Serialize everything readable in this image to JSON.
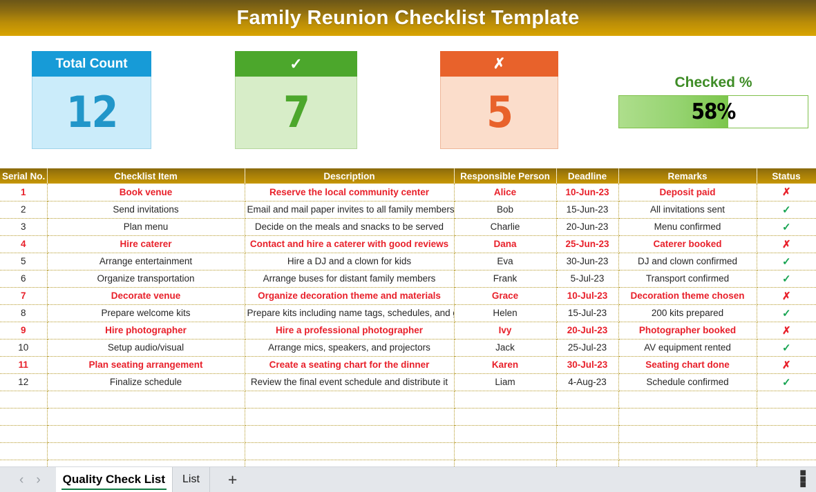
{
  "title": "Family Reunion Checklist Template",
  "cards": [
    {
      "name": "total-count",
      "header": "Total Count",
      "value": "12"
    },
    {
      "name": "checked-count",
      "header": "✓",
      "value": "7"
    },
    {
      "name": "unchecked-count",
      "header": "✗",
      "value": "5"
    }
  ],
  "progress": {
    "label": "Checked %",
    "value": "58%",
    "percent": 58
  },
  "table": {
    "columns": [
      "Serial No.",
      "Checklist Item",
      "Description",
      "Responsible Person",
      "Deadline",
      "Remarks",
      "Status"
    ],
    "rows": [
      {
        "serial": "1",
        "item": "Book venue",
        "desc": "Reserve the local community center",
        "person": "Alice",
        "deadline": "10-Jun-23",
        "remarks": "Deposit paid",
        "status": "✗",
        "flagged": true
      },
      {
        "serial": "2",
        "item": "Send invitations",
        "desc": "Email and mail paper invites to all family members",
        "person": "Bob",
        "deadline": "15-Jun-23",
        "remarks": "All invitations sent",
        "status": "✓",
        "flagged": false
      },
      {
        "serial": "3",
        "item": "Plan menu",
        "desc": "Decide on the meals and snacks to be served",
        "person": "Charlie",
        "deadline": "20-Jun-23",
        "remarks": "Menu confirmed",
        "status": "✓",
        "flagged": false
      },
      {
        "serial": "4",
        "item": "Hire caterer",
        "desc": "Contact and hire a caterer with good reviews",
        "person": "Dana",
        "deadline": "25-Jun-23",
        "remarks": "Caterer booked",
        "status": "✗",
        "flagged": true
      },
      {
        "serial": "5",
        "item": "Arrange entertainment",
        "desc": "Hire a DJ and a clown for kids",
        "person": "Eva",
        "deadline": "30-Jun-23",
        "remarks": "DJ and clown confirmed",
        "status": "✓",
        "flagged": false
      },
      {
        "serial": "6",
        "item": "Organize transportation",
        "desc": "Arrange buses for distant family members",
        "person": "Frank",
        "deadline": "5-Jul-23",
        "remarks": "Transport confirmed",
        "status": "✓",
        "flagged": false
      },
      {
        "serial": "7",
        "item": "Decorate venue",
        "desc": "Organize decoration theme and materials",
        "person": "Grace",
        "deadline": "10-Jul-23",
        "remarks": "Decoration theme chosen",
        "status": "✗",
        "flagged": true
      },
      {
        "serial": "8",
        "item": "Prepare welcome kits",
        "desc": "Prepare kits including name tags, schedules, and gifts",
        "person": "Helen",
        "deadline": "15-Jul-23",
        "remarks": "200 kits prepared",
        "status": "✓",
        "flagged": false
      },
      {
        "serial": "9",
        "item": "Hire photographer",
        "desc": "Hire a professional photographer",
        "person": "Ivy",
        "deadline": "20-Jul-23",
        "remarks": "Photographer booked",
        "status": "✗",
        "flagged": true
      },
      {
        "serial": "10",
        "item": "Setup audio/visual",
        "desc": "Arrange mics, speakers, and projectors",
        "person": "Jack",
        "deadline": "25-Jul-23",
        "remarks": "AV equipment rented",
        "status": "✓",
        "flagged": false
      },
      {
        "serial": "11",
        "item": "Plan seating arrangement",
        "desc": "Create a seating chart for the dinner",
        "person": "Karen",
        "deadline": "30-Jul-23",
        "remarks": "Seating chart done",
        "status": "✗",
        "flagged": true
      },
      {
        "serial": "12",
        "item": "Finalize schedule",
        "desc": "Review the final event schedule and distribute it",
        "person": "Liam",
        "deadline": "4-Aug-23",
        "remarks": "Schedule confirmed",
        "status": "✓",
        "flagged": false
      }
    ],
    "empty_row_count": 5
  },
  "tabbar": {
    "prev": "‹",
    "next": "›",
    "tabs": [
      {
        "label": "Quality Check List",
        "active": true
      },
      {
        "label": "List",
        "active": false
      }
    ],
    "add": "+",
    "menu": "⋮"
  },
  "colors": {
    "title_gradient_start": "#6b5618",
    "title_gradient_end": "#d9a400",
    "blue": "#179BD7",
    "green": "#4CA72C",
    "orange": "#E8622B",
    "flag_red": "#E8202A",
    "check_green": "#18A452",
    "grid_line": "#b59a2a"
  }
}
